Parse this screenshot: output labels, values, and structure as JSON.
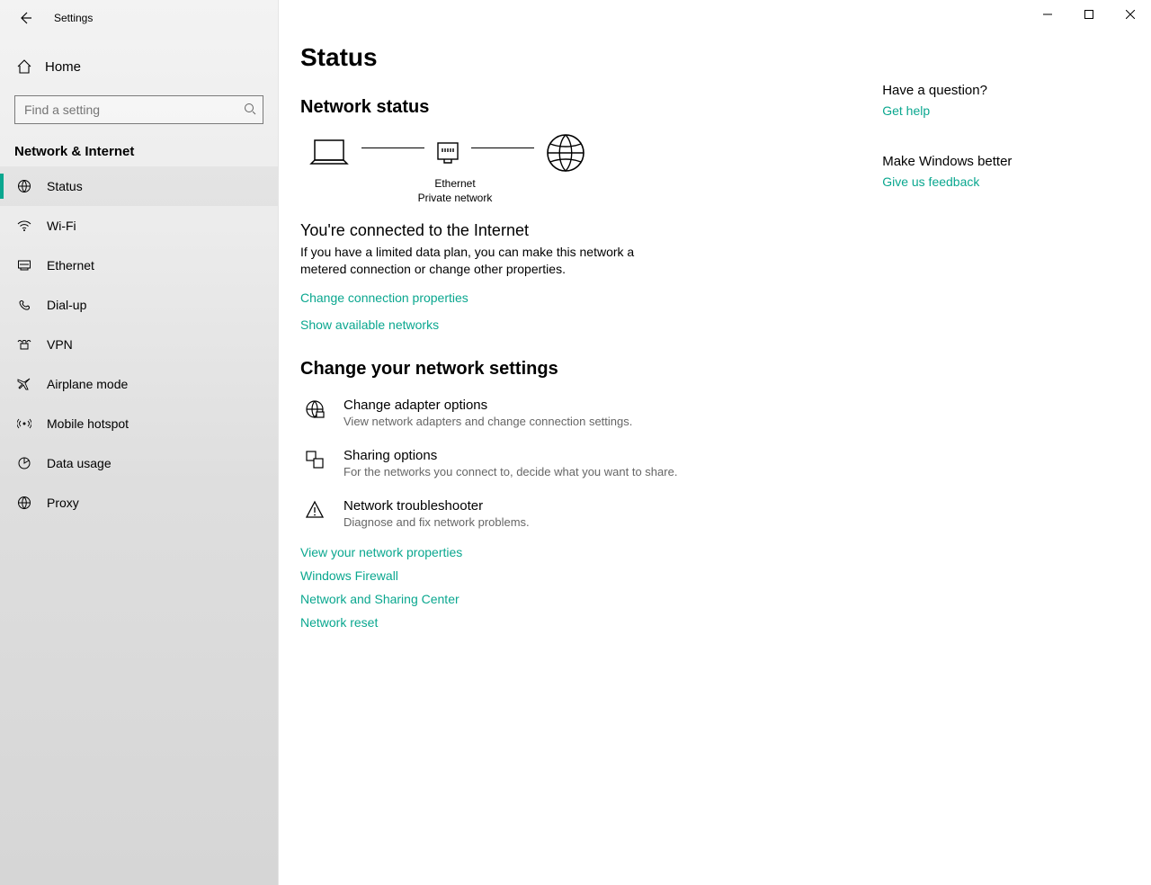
{
  "app_title": "Settings",
  "sidebar": {
    "home_label": "Home",
    "search_placeholder": "Find a setting",
    "section_title": "Network & Internet",
    "items": [
      {
        "label": "Status",
        "icon": "status-icon",
        "active": true
      },
      {
        "label": "Wi-Fi",
        "icon": "wifi-icon",
        "active": false
      },
      {
        "label": "Ethernet",
        "icon": "ethernet-icon",
        "active": false
      },
      {
        "label": "Dial-up",
        "icon": "dialup-icon",
        "active": false
      },
      {
        "label": "VPN",
        "icon": "vpn-icon",
        "active": false
      },
      {
        "label": "Airplane mode",
        "icon": "airplane-icon",
        "active": false
      },
      {
        "label": "Mobile hotspot",
        "icon": "hotspot-icon",
        "active": false
      },
      {
        "label": "Data usage",
        "icon": "datausage-icon",
        "active": false
      },
      {
        "label": "Proxy",
        "icon": "proxy-icon",
        "active": false
      }
    ]
  },
  "page": {
    "title": "Status",
    "network_status_heading": "Network status",
    "diagram_label_1": "Ethernet",
    "diagram_label_2": "Private network",
    "connected_title": "You're connected to the Internet",
    "connected_desc": "If you have a limited data plan, you can make this network a metered connection or change other properties.",
    "link_change_props": "Change connection properties",
    "link_show_networks": "Show available networks",
    "change_heading": "Change your network settings",
    "options": [
      {
        "title": "Change adapter options",
        "desc": "View network adapters and change connection settings.",
        "icon": "adapter-icon"
      },
      {
        "title": "Sharing options",
        "desc": "For the networks you connect to, decide what you want to share.",
        "icon": "sharing-icon"
      },
      {
        "title": "Network troubleshooter",
        "desc": "Diagnose and fix network problems.",
        "icon": "warning-icon"
      }
    ],
    "extra_links": [
      "View your network properties",
      "Windows Firewall",
      "Network and Sharing Center",
      "Network reset"
    ]
  },
  "help": {
    "q_heading": "Have a question?",
    "q_link": "Get help",
    "fb_heading": "Make Windows better",
    "fb_link": "Give us feedback"
  },
  "colors": {
    "accent": "#0aa78f"
  }
}
